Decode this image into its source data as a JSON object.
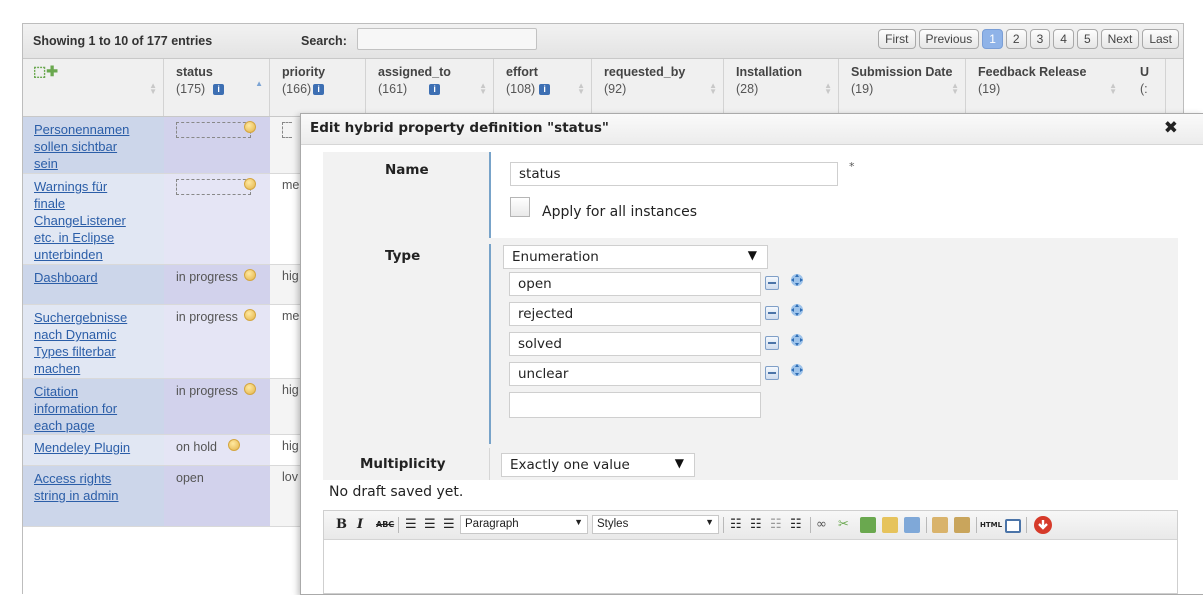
{
  "toolbar": {
    "info": "Showing 1 to 10 of 177 entries",
    "search_label": "Search:",
    "search_value": "",
    "pager": [
      "First",
      "Previous",
      "1",
      "2",
      "3",
      "4",
      "5",
      "Next",
      "Last"
    ],
    "active_page": "1"
  },
  "columns": [
    {
      "name": "status",
      "count": "(175)"
    },
    {
      "name": "priority",
      "count": "(166)"
    },
    {
      "name": "assigned_to",
      "count": "(161)"
    },
    {
      "name": "effort",
      "count": "(108)"
    },
    {
      "name": "requested_by",
      "count": "(92)"
    },
    {
      "name": "Installation",
      "count": "(28)"
    },
    {
      "name": "Submission Date",
      "count": "(19)"
    },
    {
      "name": "Feedback Release",
      "count": "(19)"
    },
    {
      "name": "U",
      "count": "(:"
    }
  ],
  "rows": [
    {
      "name": [
        "Personennamen",
        "sollen sichtbar",
        "sein"
      ],
      "status": "",
      "priority": ""
    },
    {
      "name": [
        "Warnings für",
        "finale",
        "ChangeListener",
        "etc. in Eclipse",
        "unterbinden"
      ],
      "status": "",
      "priority": "me"
    },
    {
      "name": [
        "Dashboard"
      ],
      "status": "in progress",
      "priority": "hig"
    },
    {
      "name": [
        "Suchergebnisse",
        "nach Dynamic",
        "Types filterbar",
        "machen"
      ],
      "status": "in progress",
      "priority": "me"
    },
    {
      "name": [
        "Citation",
        "information for",
        "each page"
      ],
      "status": "in progress",
      "priority": "hig"
    },
    {
      "name": [
        "Mendeley Plugin"
      ],
      "status": "on hold",
      "priority": "hig"
    },
    {
      "name": [
        "Access rights",
        "string in admin"
      ],
      "status": "open",
      "priority": "lov"
    }
  ],
  "dialog": {
    "title": "Edit hybrid property definition \"status\"",
    "close": "✖",
    "name_label": "Name",
    "name_value": "status",
    "required_mark": "*",
    "apply_all_label": "Apply for all instances",
    "type_label": "Type",
    "type_value": "Enumeration",
    "enum_values": [
      "open",
      "rejected",
      "solved",
      "unclear",
      ""
    ],
    "multiplicity_label": "Multiplicity",
    "multiplicity_value": "Exactly one value",
    "draft_note": "No draft saved yet.",
    "editor": {
      "bold": "B",
      "italic": "I",
      "spell": "ABC",
      "format": "Paragraph",
      "styles": "Styles",
      "html": "HTML"
    }
  }
}
